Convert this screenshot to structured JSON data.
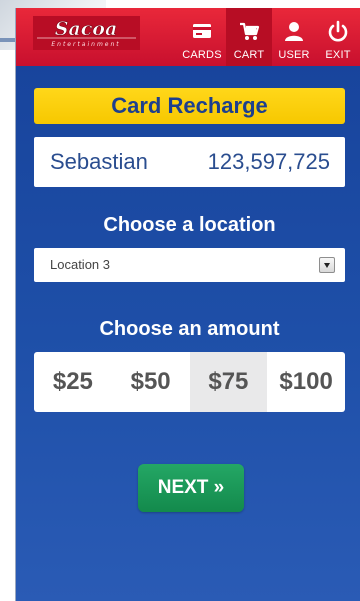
{
  "brand": {
    "logo_text": "Sacoa",
    "logo_subtext": "Entertainment"
  },
  "nav": {
    "items": [
      {
        "label": "CARDS",
        "icon": "card-icon"
      },
      {
        "label": "CART",
        "icon": "cart-icon",
        "active": true
      },
      {
        "label": "USER",
        "icon": "user-icon"
      },
      {
        "label": "EXIT",
        "icon": "power-icon"
      }
    ]
  },
  "page": {
    "title": "Card Recharge"
  },
  "account": {
    "name": "Sebastian",
    "number": "123,597,725"
  },
  "location": {
    "label": "Choose a location",
    "selected": "Location 3"
  },
  "amount": {
    "label": "Choose an amount",
    "options": [
      "$25",
      "$50",
      "$75",
      "$100"
    ],
    "selected": "$75"
  },
  "actions": {
    "next_label": "NEXT »"
  },
  "colors": {
    "header_red": "#c8102e",
    "app_blue": "#1e4fa8",
    "title_yellow": "#f7c800",
    "next_green": "#1a9a58"
  }
}
